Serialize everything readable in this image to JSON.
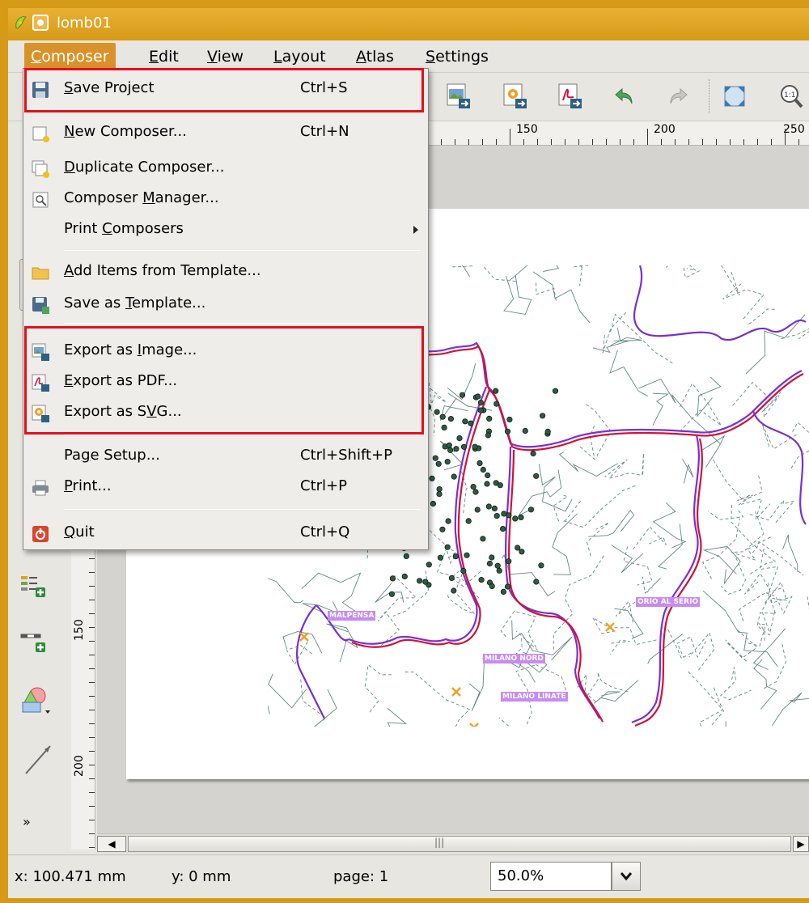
{
  "window": {
    "title": "lomb01"
  },
  "menubar": {
    "items": [
      {
        "pre": "",
        "ul": "C",
        "post": "omposer"
      },
      {
        "pre": "",
        "ul": "E",
        "post": "dit"
      },
      {
        "pre": "",
        "ul": "V",
        "post": "iew"
      },
      {
        "pre": "",
        "ul": "L",
        "post": "ayout"
      },
      {
        "pre": "",
        "ul": "A",
        "post": "tlas"
      },
      {
        "pre": "",
        "ul": "S",
        "post": "ettings"
      }
    ]
  },
  "ruler_top": {
    "labels": [
      "150",
      "200",
      "250"
    ]
  },
  "ruler_left": {
    "labels": [
      "150",
      "200"
    ]
  },
  "composer_menu": {
    "items": [
      {
        "pre": "",
        "ul": "S",
        "post": "ave Project",
        "shortcut": "Ctrl+S"
      },
      {
        "pre": "",
        "ul": "N",
        "post": "ew Composer...",
        "shortcut": "Ctrl+N"
      },
      {
        "pre": "",
        "ul": "D",
        "post": "uplicate Composer...",
        "shortcut": ""
      },
      {
        "pre": "Composer ",
        "ul": "M",
        "post": "anager...",
        "shortcut": ""
      },
      {
        "pre": "Print ",
        "ul": "C",
        "post": "omposers",
        "shortcut": ""
      },
      {
        "pre": "",
        "ul": "A",
        "post": "dd Items from Template...",
        "shortcut": ""
      },
      {
        "pre": "Save as ",
        "ul": "T",
        "post": "emplate...",
        "shortcut": ""
      },
      {
        "pre": "Export as ",
        "ul": "I",
        "post": "mage...",
        "shortcut": ""
      },
      {
        "pre": "",
        "ul": "E",
        "post": "xport as PDF...",
        "shortcut": ""
      },
      {
        "pre": "Export as S",
        "ul": "V",
        "post": "G...",
        "shortcut": ""
      },
      {
        "pre": "Pa",
        "ul": "g",
        "post": "e Setup...",
        "shortcut": "Ctrl+Shift+P"
      },
      {
        "pre": "",
        "ul": "P",
        "post": "rint...",
        "shortcut": "Ctrl+P"
      },
      {
        "pre": "",
        "ul": "Q",
        "post": "uit",
        "shortcut": "Ctrl+Q"
      }
    ]
  },
  "map": {
    "labels": [
      "MALPENSA",
      "ORIO AL SERIO",
      "MILANO NORD",
      "MILANO LINATE"
    ]
  },
  "statusbar": {
    "x": "x: 100.471 mm",
    "y": "y: 0 mm",
    "page": "page: 1",
    "zoom": "50.0%"
  },
  "colors": {
    "titlebar": "#d69a17",
    "menu_active": "#d9922a",
    "highlight_box": "#e3101b",
    "border_purple": "#7a2fd0",
    "border_red": "#d3103b",
    "points": "#2f5a44",
    "label_bg": "#c78bf2",
    "airport": "#f0a020"
  }
}
